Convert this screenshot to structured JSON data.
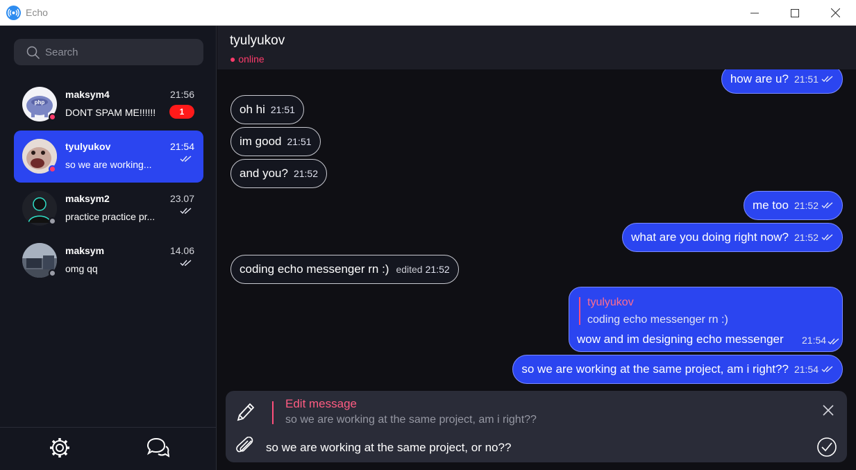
{
  "window": {
    "title": "Echo"
  },
  "sidebar": {
    "search_placeholder": "Search",
    "chats": [
      {
        "name": "maksym4",
        "time": "21:56",
        "preview": "DONT SPAM ME!!!!!!",
        "unread": "1",
        "online": true,
        "active": false
      },
      {
        "name": "tyulyukov",
        "time": "21:54",
        "preview": "so we are working...",
        "online": true,
        "active": true
      },
      {
        "name": "maksym2",
        "time": "23.07",
        "preview": "practice practice pr...",
        "online": false,
        "active": false
      },
      {
        "name": "maksym",
        "time": "14.06",
        "preview": "omg qq",
        "online": false,
        "active": false
      }
    ],
    "footer": {
      "settings_icon": "gear-icon",
      "chats_icon": "chat-bubbles-icon"
    }
  },
  "chat": {
    "contact_name": "tyulyukov",
    "status": "● online",
    "messages": [
      {
        "direction": "out",
        "text": "how are u?",
        "time": "21:51"
      },
      {
        "direction": "in",
        "text": "oh hi",
        "time": "21:51"
      },
      {
        "direction": "in",
        "text": "im good",
        "time": "21:51"
      },
      {
        "direction": "in",
        "text": "and you?",
        "time": "21:52"
      },
      {
        "direction": "out",
        "text": "me too",
        "time": "21:52"
      },
      {
        "direction": "out",
        "text": "what are you doing right now?",
        "time": "21:52"
      },
      {
        "direction": "in",
        "text": "coding echo messenger rn :)",
        "time": "21:52",
        "edited": "edited"
      },
      {
        "direction": "out",
        "reply_author": "tyulyukov",
        "reply_text": "coding echo messenger rn :)",
        "text": "wow and im designing echo messenger",
        "time": "21:54"
      },
      {
        "direction": "out",
        "text": "so we are working at the same project, am i right??",
        "time": "21:54"
      }
    ]
  },
  "compose": {
    "edit_title": "Edit message",
    "edit_original": "so we are working at the same project, am i right??",
    "input_value": "so we are working at the same project, or no??"
  },
  "colors": {
    "accent": "#2b45f0",
    "online": "#ff3b6b",
    "unread_badge": "#ff1a1a",
    "sidebar_bg": "#14161f",
    "chat_bg": "#0f0f14"
  }
}
